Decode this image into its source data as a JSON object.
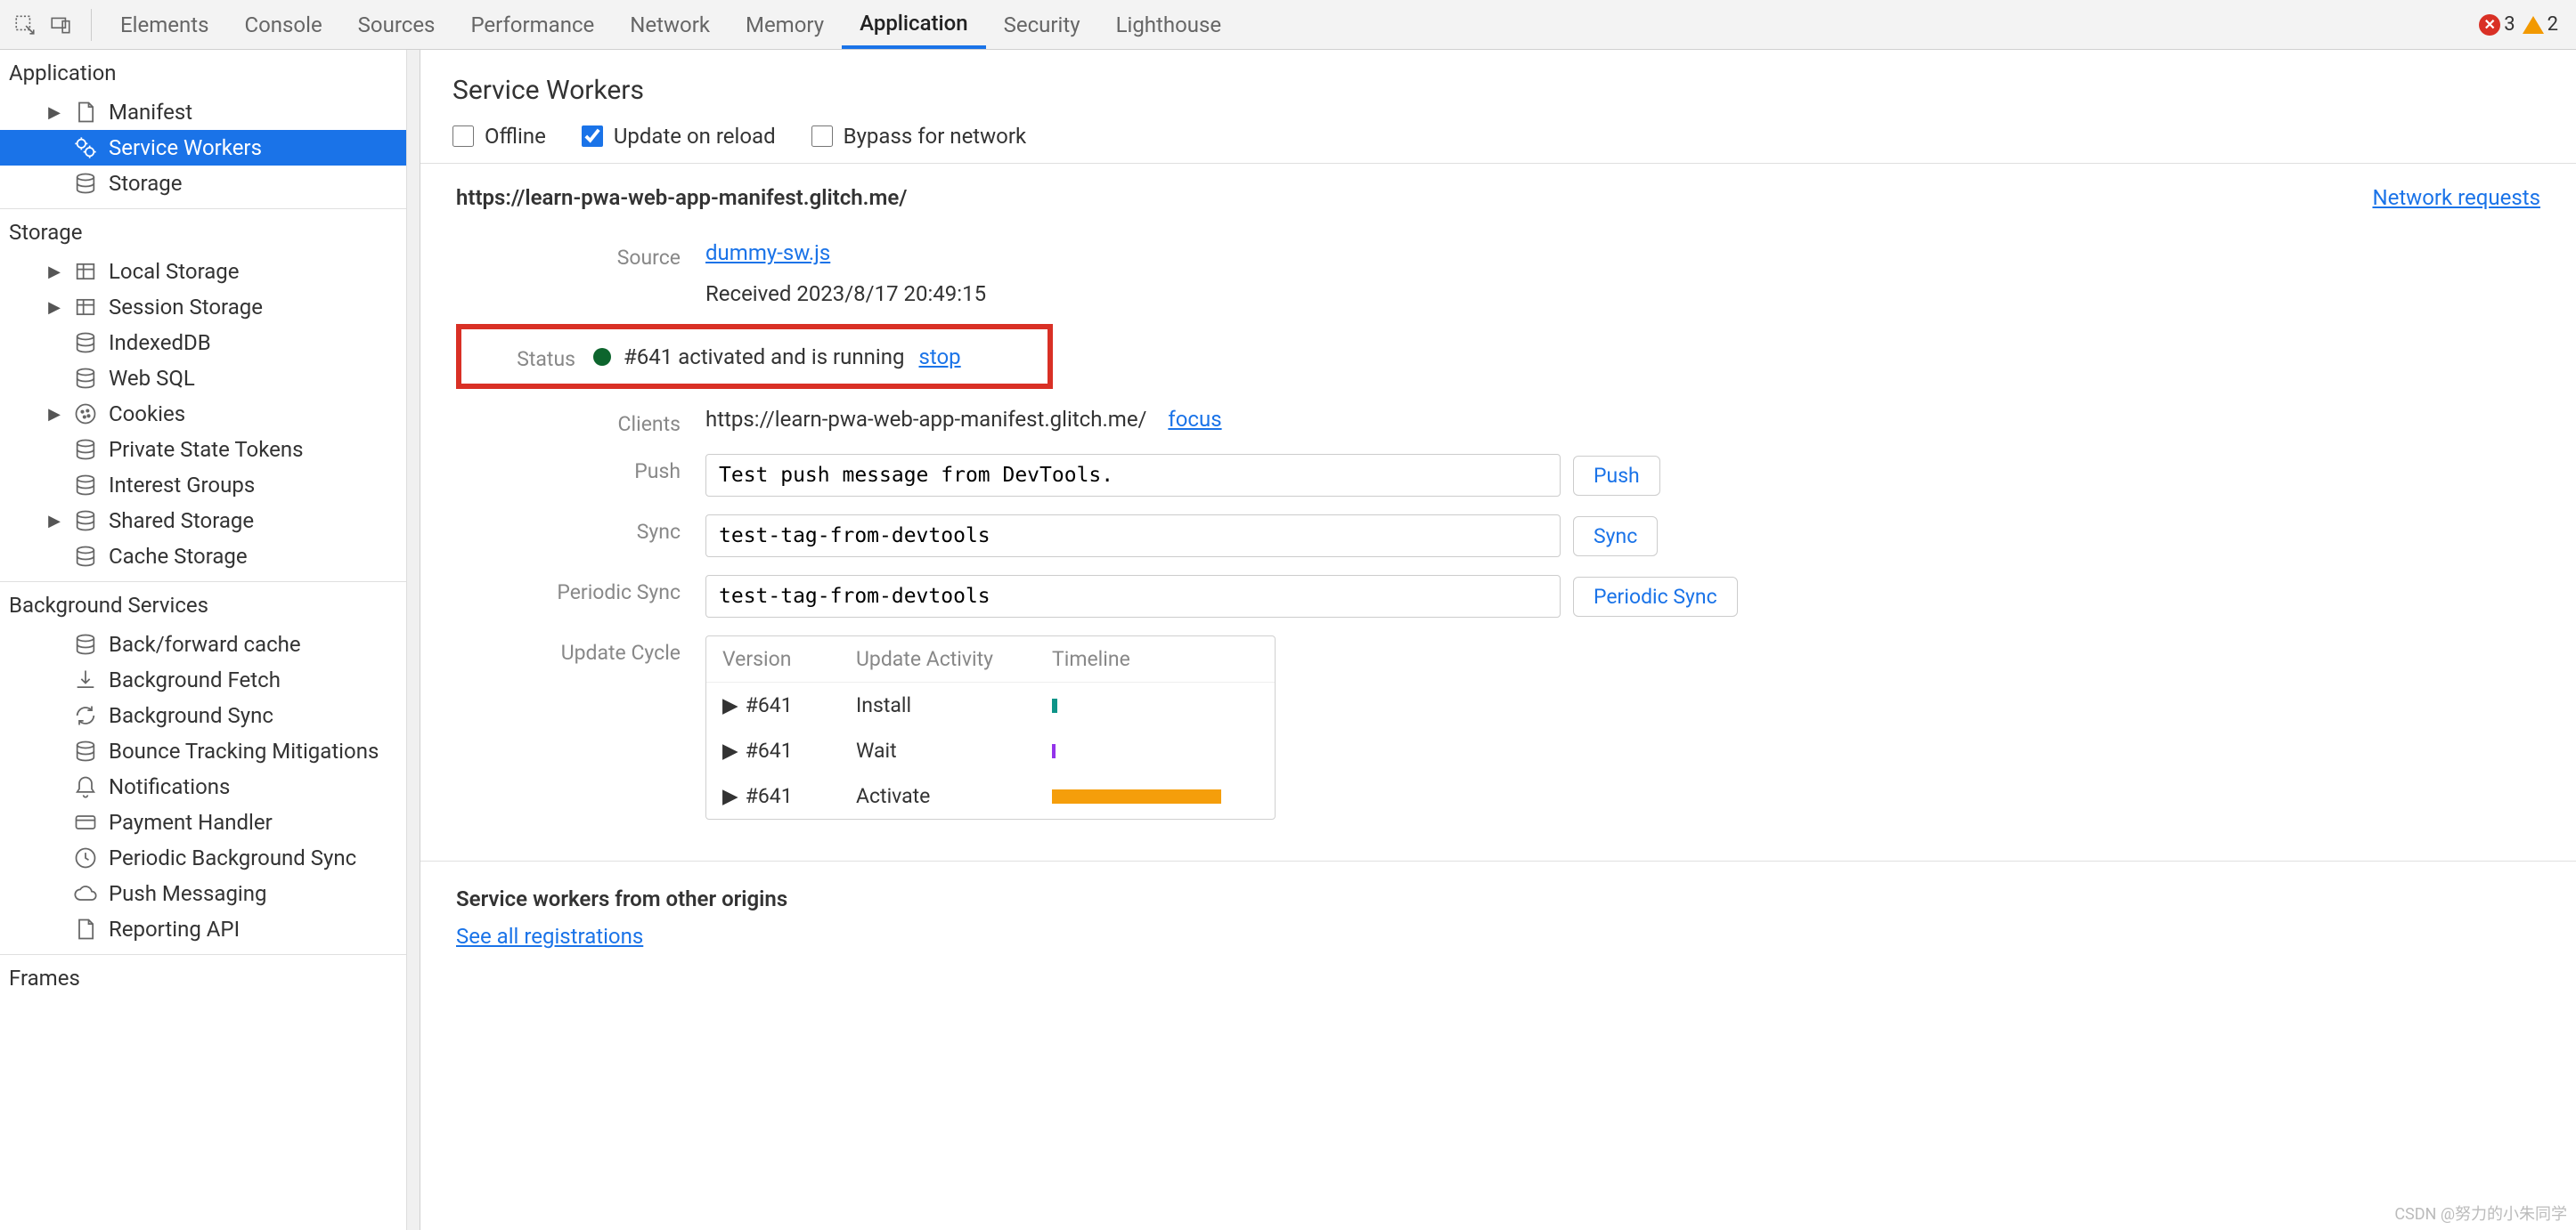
{
  "toolbar": {
    "tabs": [
      "Elements",
      "Console",
      "Sources",
      "Performance",
      "Network",
      "Memory",
      "Application",
      "Security",
      "Lighthouse"
    ],
    "active_tab": "Application",
    "errors": "3",
    "warnings": "2"
  },
  "sidebar": {
    "sections": {
      "application": {
        "title": "Application",
        "items": [
          "Manifest",
          "Service Workers",
          "Storage"
        ],
        "selected": "Service Workers"
      },
      "storage": {
        "title": "Storage",
        "items": [
          "Local Storage",
          "Session Storage",
          "IndexedDB",
          "Web SQL",
          "Cookies",
          "Private State Tokens",
          "Interest Groups",
          "Shared Storage",
          "Cache Storage"
        ]
      },
      "bgservices": {
        "title": "Background Services",
        "items": [
          "Back/forward cache",
          "Background Fetch",
          "Background Sync",
          "Bounce Tracking Mitigations",
          "Notifications",
          "Payment Handler",
          "Periodic Background Sync",
          "Push Messaging",
          "Reporting API"
        ]
      },
      "frames": {
        "title": "Frames"
      }
    }
  },
  "content": {
    "title": "Service Workers",
    "checkboxes": {
      "offline": {
        "label": "Offline",
        "checked": false
      },
      "update_reload": {
        "label": "Update on reload",
        "checked": true
      },
      "bypass": {
        "label": "Bypass for network",
        "checked": false
      }
    },
    "origin": "https://learn-pwa-web-app-manifest.glitch.me/",
    "network_requests": "Network requests",
    "rows": {
      "source": {
        "label": "Source",
        "file": "dummy-sw.js",
        "received": "Received 2023/8/17 20:49:15"
      },
      "status": {
        "label": "Status",
        "text": "#641 activated and is running",
        "stop": "stop"
      },
      "clients": {
        "label": "Clients",
        "url": "https://learn-pwa-web-app-manifest.glitch.me/",
        "focus": "focus"
      },
      "push": {
        "label": "Push",
        "value": "Test push message from DevTools.",
        "button": "Push"
      },
      "sync": {
        "label": "Sync",
        "value": "test-tag-from-devtools",
        "button": "Sync"
      },
      "periodic_sync": {
        "label": "Periodic Sync",
        "value": "test-tag-from-devtools",
        "button": "Periodic Sync"
      },
      "update_cycle": {
        "label": "Update Cycle",
        "headers": [
          "Version",
          "Update Activity",
          "Timeline"
        ],
        "rows": [
          {
            "version": "#641",
            "activity": "Install"
          },
          {
            "version": "#641",
            "activity": "Wait"
          },
          {
            "version": "#641",
            "activity": "Activate"
          }
        ]
      }
    },
    "other_origins": {
      "title": "Service workers from other origins",
      "link": "See all registrations"
    }
  },
  "watermark": "CSDN @努力的小朱同学"
}
